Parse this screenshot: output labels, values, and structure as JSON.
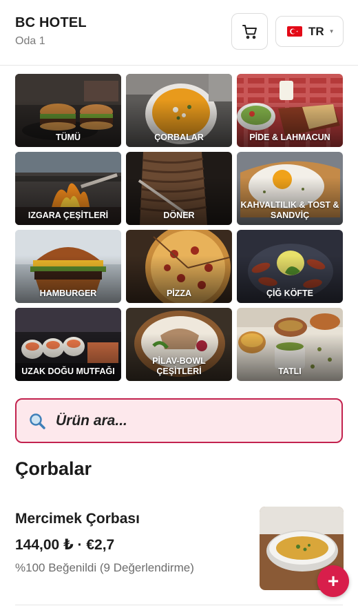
{
  "header": {
    "hotel_name": "BC HOTEL",
    "room": "Oda 1",
    "cart_icon": "cart-icon",
    "language": {
      "code": "TR",
      "flag": "turkey-flag-icon"
    }
  },
  "categories": [
    {
      "label": "TÜMÜ"
    },
    {
      "label": "ÇORBALAR"
    },
    {
      "label": "PİDE & LAHMACUN"
    },
    {
      "label": "IZGARA ÇEŞİTLERİ"
    },
    {
      "label": "DÖNER"
    },
    {
      "label": "KAHVALTILIK & TOST & SANDVİÇ"
    },
    {
      "label": "HAMBURGER"
    },
    {
      "label": "PİZZA"
    },
    {
      "label": "ÇİĞ KÖFTE"
    },
    {
      "label": "UZAK DOĞU MUTFAĞI"
    },
    {
      "label": "PİLAV-BOWL ÇEŞİTLERİ"
    },
    {
      "label": "TATLI"
    }
  ],
  "search": {
    "placeholder": "Ürün ara..."
  },
  "section": {
    "title": "Çorbalar"
  },
  "products": [
    {
      "name": "Mercimek Çorbası",
      "price": "144,00 ₺ · €2,7",
      "rating": "%100 Beğenildi (9 Değerlendirme)",
      "add_label": "+"
    }
  ],
  "colors": {
    "accent": "#d81e4b",
    "search_bg": "#fde8ec",
    "search_border": "#c2224e"
  }
}
